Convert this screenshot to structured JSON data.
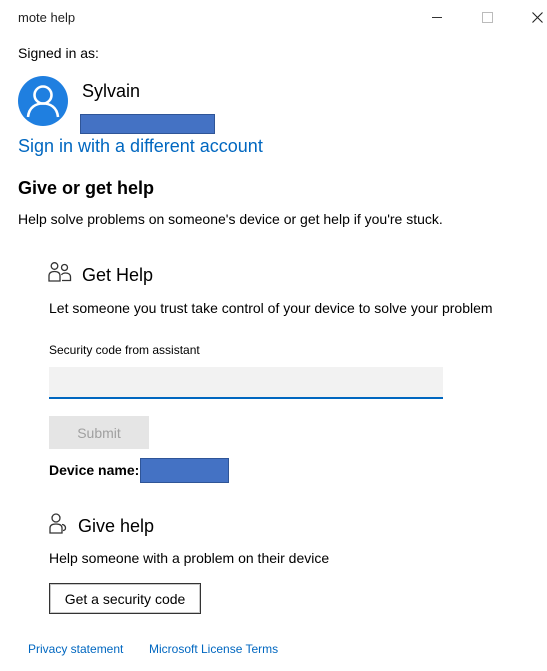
{
  "window": {
    "title": "mote help",
    "controls": {
      "minimize": "minimize",
      "maximize": "maximize",
      "close": "✕"
    }
  },
  "account": {
    "signed_in_label": "Signed in as:",
    "name": "Sylvain",
    "switch_link": "Sign in with a different account",
    "avatar_color": "#1f7fe0"
  },
  "main": {
    "heading": "Give or get help",
    "description": "Help solve problems on someone's device or get help if you're stuck."
  },
  "get_help": {
    "icon": "people-icon",
    "title": "Get Help",
    "description": "Let someone you trust take control of your device to solve your problem",
    "code_label": "Security code from assistant",
    "code_value": "",
    "submit_label": "Submit",
    "device_name_label": "Device name:"
  },
  "give_help": {
    "icon": "person-help-icon",
    "title": "Give help",
    "description": "Help someone with a problem on their device",
    "button_label": "Get a security code"
  },
  "footer": {
    "privacy": "Privacy statement",
    "license": "Microsoft License Terms"
  },
  "colors": {
    "accent": "#0067c0",
    "redaction": "#4472c4",
    "disabled_bg": "#e5e5e5",
    "disabled_text": "#a0a0a0"
  }
}
